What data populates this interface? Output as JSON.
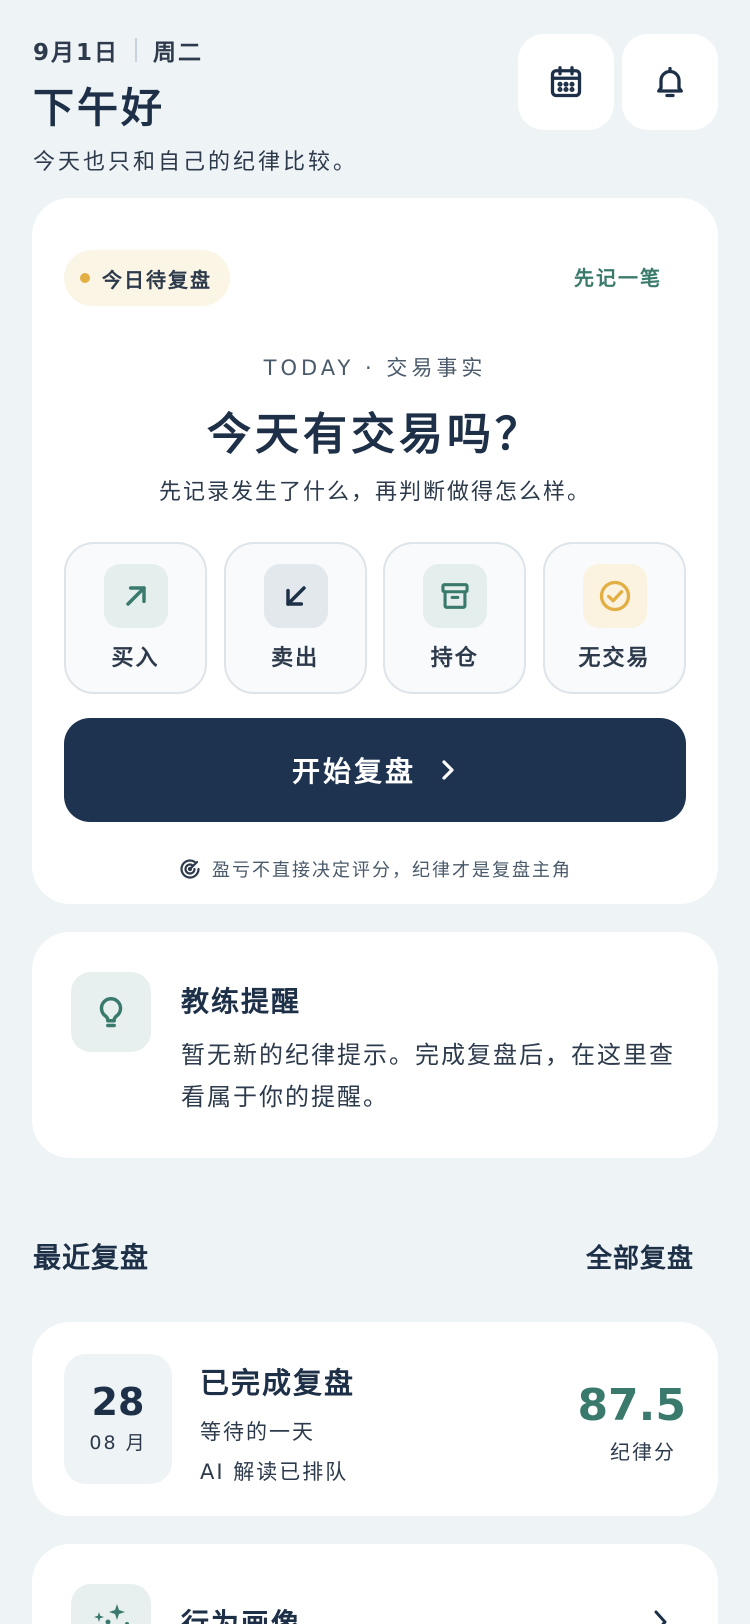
{
  "header": {
    "date": "9月1日",
    "weekday": "周二",
    "greeting": "下午好",
    "tagline": "今天也只和自己的纪律比较。",
    "calendar_icon": "calendar-icon",
    "bell_icon": "bell-icon"
  },
  "today_card": {
    "status_pill": "今日待复盘",
    "quick_note_link": "先记一笔",
    "kicker": "TODAY · 交易事实",
    "question": "今天有交易吗？",
    "explain": "先记录发生了什么，再判断做得怎么样。",
    "options": [
      {
        "label": "买入",
        "icon": "arrow-up-right-icon"
      },
      {
        "label": "卖出",
        "icon": "arrow-down-left-icon"
      },
      {
        "label": "持仓",
        "icon": "archive-box-icon"
      },
      {
        "label": "无交易",
        "icon": "check-circle-icon"
      }
    ],
    "start_button": "开始复盘",
    "footer_note": "盈亏不直接决定评分，纪律才是复盘主角"
  },
  "coach": {
    "title": "教练提醒",
    "body": "暂无新的纪律提示。完成复盘后，在这里查看属于你的提醒。",
    "icon": "lightbulb-icon"
  },
  "recent": {
    "title": "最近复盘",
    "all_link": "全部复盘",
    "items": [
      {
        "day": "28",
        "month": "08 月",
        "title": "已完成复盘",
        "subtitle": "等待的一天",
        "ai_status": "AI 解读已排队",
        "score": "87.5",
        "score_label": "纪律分"
      }
    ]
  },
  "profile": {
    "title": "行为画像",
    "icon": "sparkles-icon"
  },
  "colors": {
    "background": "#eef3f6",
    "navy": "#1e3350",
    "teal": "#3a7a6c",
    "gold": "#e3ae43"
  }
}
